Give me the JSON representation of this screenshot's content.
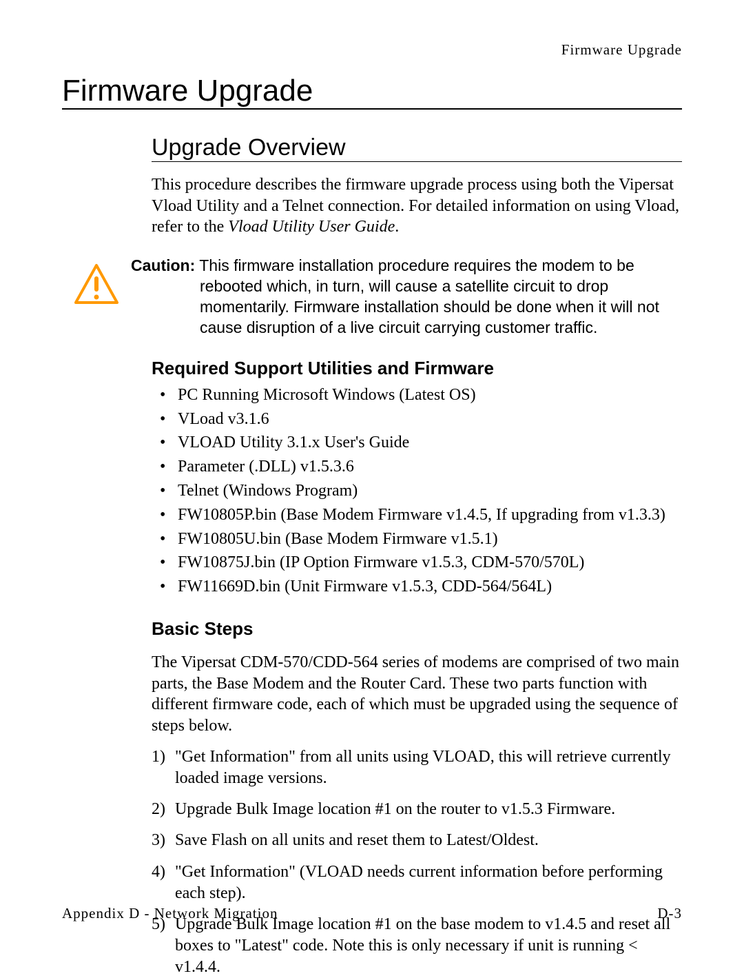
{
  "header": {
    "running_head": "Firmware Upgrade",
    "title": "Firmware Upgrade"
  },
  "overview": {
    "heading": "Upgrade Overview",
    "intro_a": "This procedure describes the firmware upgrade process using both the Vipersat Vload Utility and a Telnet connection. For detailed information on using Vload, refer to the ",
    "intro_italic": "Vload Utility User Guide",
    "intro_b": "."
  },
  "caution": {
    "label": "Caution:",
    "text": "This firmware installation procedure requires the modem to be rebooted which, in turn, will cause a satellite circuit to drop momentarily. Firmware installation should be done when it will not cause disruption of a live circuit carrying customer traffic."
  },
  "required": {
    "heading": "Required Support Utilities and Firmware",
    "items": [
      "PC Running Microsoft Windows (Latest OS)",
      "VLoad v3.1.6",
      "VLOAD Utility 3.1.x User's Guide",
      "Parameter (.DLL) v1.5.3.6",
      "Telnet (Windows Program)",
      "FW10805P.bin (Base Modem Firmware v1.4.5, If upgrading from v1.3.3)",
      "FW10805U.bin (Base Modem Firmware v1.5.1)",
      "FW10875J.bin (IP Option Firmware v1.5.3, CDM-570/570L)",
      "FW11669D.bin (Unit Firmware v1.5.3, CDD-564/564L)"
    ]
  },
  "steps": {
    "heading": "Basic Steps",
    "intro": "The Vipersat CDM-570/CDD-564 series of modems are comprised of two main parts, the Base Modem and the Router Card. These two parts function with different firmware code, each of which must be upgraded using the sequence of steps below.",
    "items": [
      "\"Get Information\" from all units using VLOAD, this will retrieve currently loaded image versions.",
      "Upgrade Bulk Image location #1 on the router to v1.5.3 Firmware.",
      "Save Flash on all units and reset them to Latest/Oldest.",
      "\"Get Information\" (VLOAD needs current information before performing each step).",
      "Upgrade Bulk Image location #1 on the base modem to v1.4.5 and reset all boxes to \"Latest\" code. Note this is only necessary if unit is running < v1.4.4."
    ]
  },
  "footer": {
    "left": "Appendix D - Network Migration",
    "right": "D-3"
  }
}
